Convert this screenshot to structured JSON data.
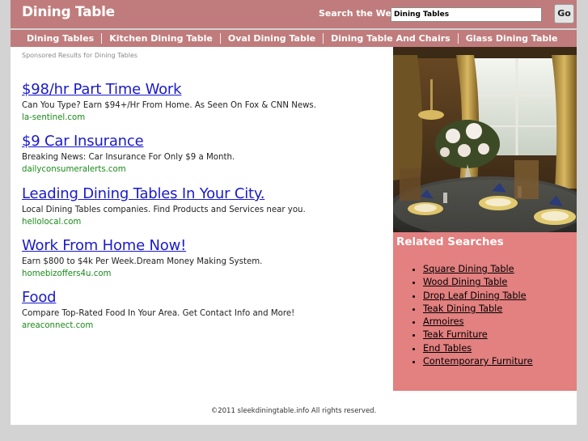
{
  "header": {
    "site_title": "Dining Table",
    "search_label": "Search the Web:",
    "search_value": "Dining Tables",
    "go_label": "Go"
  },
  "nav": {
    "items": [
      {
        "label": "Dining Tables"
      },
      {
        "label": "Kitchen Dining Table"
      },
      {
        "label": "Oval Dining Table"
      },
      {
        "label": "Dining Table And Chairs"
      },
      {
        "label": "Glass Dining Table"
      }
    ]
  },
  "main": {
    "sponsored_label": "Sponsored Results for Dining Tables",
    "ads": [
      {
        "title": "$98/hr Part Time Work",
        "desc": "Can You Type? Earn $94+/Hr From Home. As Seen On Fox & CNN News.",
        "url": "la-sentinel.com"
      },
      {
        "title": "$9 Car Insurance",
        "desc": "Breaking News: Car Insurance For Only $9 a Month.",
        "url": "dailyconsumeralerts.com"
      },
      {
        "title": "Leading Dining Tables In Your City.",
        "desc": "Local Dining Tables companies. Find Products and Services near you.",
        "url": "hellolocal.com"
      },
      {
        "title": "Work From Home Now!",
        "desc": "Earn $800 to $4k Per Week.Dream Money Making System.",
        "url": "homebizoffers4u.com"
      },
      {
        "title": "Food",
        "desc": "Compare Top-Rated Food In Your Area. Get Contact Info and More!",
        "url": "areaconnect.com"
      }
    ]
  },
  "sidebar": {
    "related_title": "Related Searches",
    "related": [
      {
        "label": "Square Dining Table"
      },
      {
        "label": "Wood Dining Table"
      },
      {
        "label": "Drop Leaf Dining Table"
      },
      {
        "label": "Teak Dining Table"
      },
      {
        "label": "Armoires"
      },
      {
        "label": "Teak Furniture"
      },
      {
        "label": "End Tables"
      },
      {
        "label": "Contemporary Furniture"
      }
    ]
  },
  "footer": {
    "copyright": "©2011 sleekdiningtable.info All rights reserved."
  },
  "colors": {
    "header_bg": "#c07c7c",
    "related_bg": "#e38080",
    "link_blue": "#1a1acc",
    "url_green": "#1a8a1a",
    "page_bg": "#d3d3d3"
  }
}
